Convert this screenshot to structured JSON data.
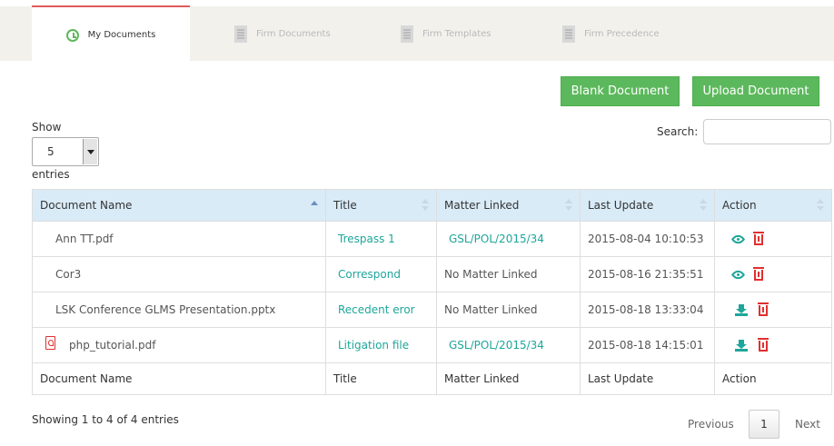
{
  "tabs": [
    {
      "label": "My Documents",
      "icon": "clock-icon",
      "active": true
    },
    {
      "label": "Firm Documents",
      "icon": "building-icon",
      "active": false
    },
    {
      "label": "Firm Templates",
      "icon": "building-icon",
      "active": false
    },
    {
      "label": "Firm Precedence",
      "icon": "building-icon",
      "active": false
    }
  ],
  "buttons": {
    "blank": "Blank Document",
    "upload": "Upload Document"
  },
  "length_menu": {
    "show": "Show",
    "value": "5",
    "entries": "entries"
  },
  "search": {
    "label": "Search:",
    "value": ""
  },
  "table": {
    "headers": [
      "Document Name",
      "Title",
      "Matter Linked",
      "Last Update",
      "Action"
    ],
    "footers": [
      "Document Name",
      "Title",
      "Matter Linked",
      "Last Update",
      "Action"
    ],
    "rows": [
      {
        "document": "Ann TT.pdf",
        "title": "Trespass 1",
        "matter": "GSL/POL/2015/34",
        "updated": "2015-08-04 10:10:53",
        "action": "view"
      },
      {
        "document": "Cor3",
        "title": "Correspond",
        "matter": "No Matter Linked",
        "updated": "2015-08-16 21:35:51",
        "action": "view"
      },
      {
        "document": "LSK Conference GLMS Presentation.pptx",
        "title": "Recedent eror",
        "matter": "No Matter Linked",
        "updated": "2015-08-18 13:33:04",
        "action": "download"
      },
      {
        "document": "php_tutorial.pdf",
        "title": "Litigation file",
        "matter": "GSL/POL/2015/34",
        "updated": "2015-08-18 14:15:01",
        "action": "download"
      }
    ]
  },
  "info": "Showing 1 to 4 of 4 entries",
  "pagination": {
    "previous": "Previous",
    "page": "1",
    "next": "Next"
  },
  "colors": {
    "accent_green": "#5cb85c",
    "link_teal": "#1ea69a",
    "delete_red": "#e0302f",
    "header_blue": "#d9ebf7"
  }
}
